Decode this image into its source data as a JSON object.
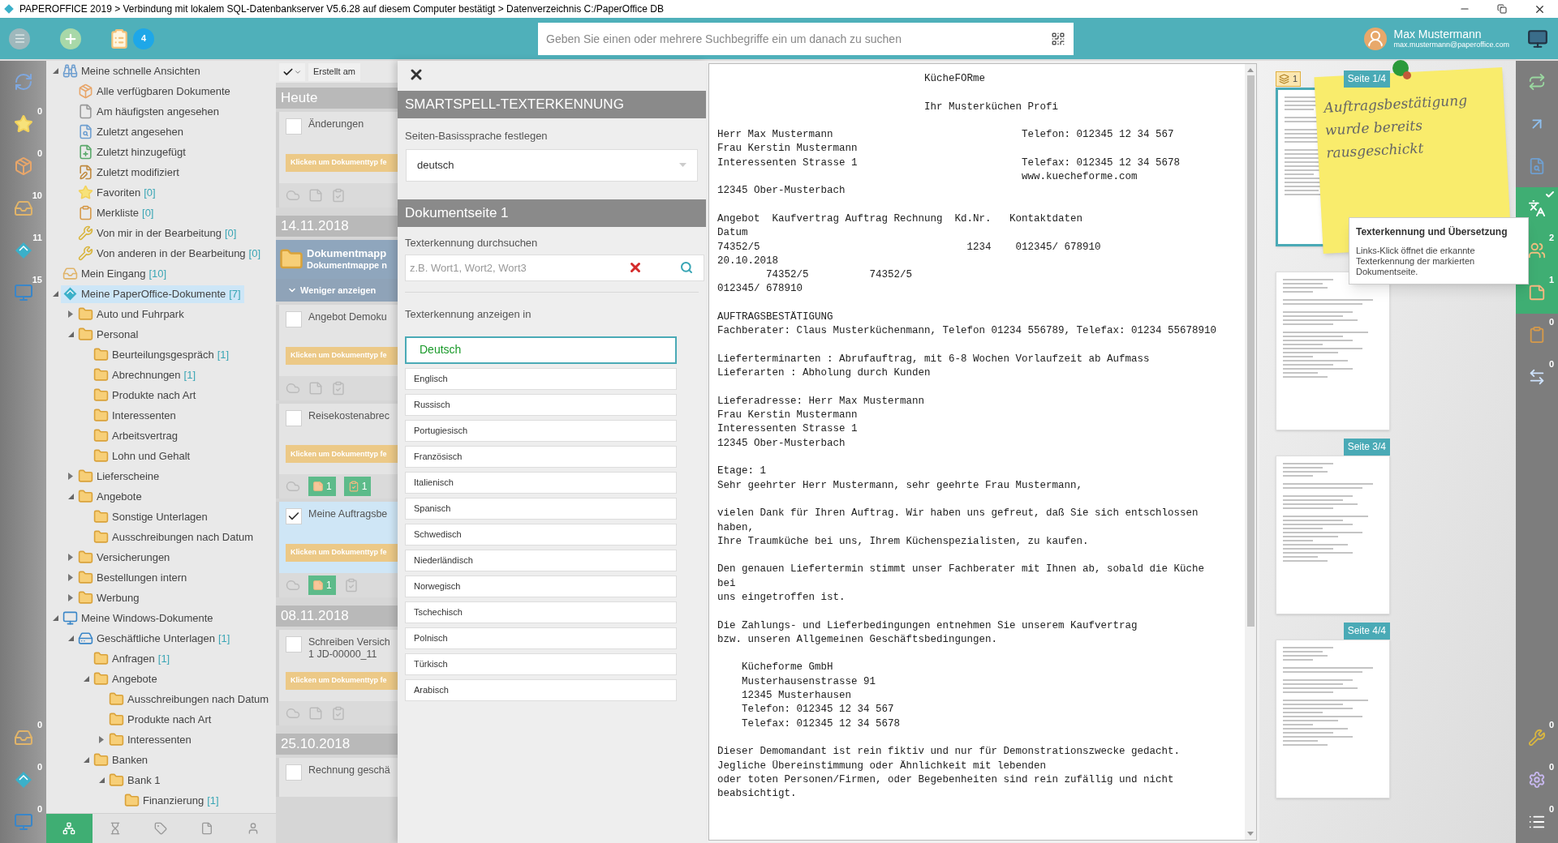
{
  "window": {
    "title": "PAPEROFFICE 2019 > Verbindung mit lokalem SQL-Datenbankserver V5.6.28 auf diesem Computer bestätigt > Datenverzeichnis C:/PaperOffice DB"
  },
  "toolbar": {
    "task_count": "4",
    "search": {
      "placeholder": "Geben Sie einen oder mehrere Suchbegriffe ein um danach zu suchen"
    },
    "user": {
      "name": "Max Mustermann",
      "email": "max.mustermann@paperoffice.com"
    }
  },
  "left_rail": {
    "top": [
      {
        "kind": "refresh"
      },
      {
        "kind": "star",
        "count": "0"
      },
      {
        "kind": "box",
        "count": "0"
      },
      {
        "kind": "inbox",
        "count": "10"
      },
      {
        "kind": "paperoffice",
        "count": "11"
      },
      {
        "kind": "windows",
        "count": "15"
      }
    ],
    "bottom": [
      {
        "kind": "inbox",
        "count": "0"
      },
      {
        "kind": "paperoffice",
        "count": "0"
      },
      {
        "kind": "windows",
        "count": "0"
      }
    ]
  },
  "tree": [
    {
      "label": "Meine schnelle Ansichten",
      "kind": "binoculars",
      "expanded": true,
      "selected": false,
      "children": [
        {
          "label": "Alle verfügbaren Dokumente",
          "kind": "box",
          "selected": false
        },
        {
          "label": "Am häufigsten angesehen",
          "kind": "file",
          "selected": false
        },
        {
          "label": "Zuletzt angesehen",
          "kind": "filesearch",
          "selected": false
        },
        {
          "label": "Zuletzt hinzugefügt",
          "kind": "fileplus",
          "selected": false
        },
        {
          "label": "Zuletzt modifiziert",
          "kind": "filepen",
          "selected": false
        },
        {
          "label": "Favoriten",
          "count": "[0]",
          "kind": "star",
          "selected": false
        },
        {
          "label": "Merkliste",
          "count": "[0]",
          "kind": "clipboard",
          "selected": false
        },
        {
          "label": "Von mir in der Bearbeitung",
          "count": "[0]",
          "kind": "wrench",
          "selected": false
        },
        {
          "label": "Von anderen in der Bearbeitung",
          "count": "[0]",
          "kind": "wrench",
          "selected": false
        }
      ]
    },
    {
      "label": "Mein Eingang",
      "count": "[10]",
      "kind": "inbox",
      "selected": false
    },
    {
      "label": "Meine PaperOffice-Dokumente",
      "count": "[7]",
      "kind": "paperoffice",
      "expanded": true,
      "selected": true,
      "children": [
        {
          "label": "Auto und Fuhrpark",
          "kind": "folder",
          "expanded": false,
          "selected": false
        },
        {
          "label": "Personal",
          "kind": "folder",
          "expanded": true,
          "selected": false,
          "children": [
            {
              "label": "Beurteilungsgespräch",
              "count": "[1]",
              "kind": "folder",
              "selected": false
            },
            {
              "label": "Abrechnungen",
              "count": "[1]",
              "kind": "folder",
              "selected": false
            },
            {
              "label": "Produkte nach Art",
              "kind": "folder",
              "selected": false
            },
            {
              "label": "Interessenten",
              "kind": "folder",
              "selected": false
            },
            {
              "label": "Arbeitsvertrag",
              "kind": "folder",
              "selected": false
            },
            {
              "label": "Lohn und Gehalt",
              "kind": "folder",
              "selected": false
            }
          ]
        },
        {
          "label": "Lieferscheine",
          "kind": "folder",
          "expanded": false,
          "selected": false
        },
        {
          "label": "Angebote",
          "kind": "folder",
          "expanded": true,
          "selected": false,
          "children": [
            {
              "label": "Sonstige Unterlagen",
              "kind": "folder",
              "selected": false
            },
            {
              "label": "Ausschreibungen nach Datum",
              "kind": "folder",
              "selected": false
            }
          ]
        },
        {
          "label": "Versicherungen",
          "kind": "folder",
          "expanded": false,
          "selected": false
        },
        {
          "label": "Bestellungen intern",
          "kind": "folder",
          "expanded": false,
          "selected": false
        },
        {
          "label": "Werbung",
          "kind": "folder",
          "expanded": false,
          "selected": false
        }
      ]
    },
    {
      "label": "Meine Windows-Dokumente",
      "kind": "windows",
      "expanded": true,
      "selected": false,
      "children": [
        {
          "label": "Geschäftliche Unterlagen",
          "count": "[1]",
          "kind": "drive",
          "expanded": true,
          "selected": false,
          "children": [
            {
              "label": "Anfragen",
              "count": "[1]",
              "kind": "folder",
              "selected": false
            },
            {
              "label": "Angebote",
              "kind": "folder",
              "expanded": true,
              "selected": false,
              "children": [
                {
                  "label": "Ausschreibungen nach Datum",
                  "kind": "folder",
                  "selected": false
                },
                {
                  "label": "Produkte nach Art",
                  "kind": "folder",
                  "selected": false
                },
                {
                  "label": "Interessenten",
                  "kind": "folder",
                  "expanded": false,
                  "selected": false
                }
              ]
            },
            {
              "label": "Banken",
              "kind": "folder",
              "expanded": true,
              "selected": false,
              "children": [
                {
                  "label": "Bank 1",
                  "kind": "folder",
                  "expanded": true,
                  "selected": false,
                  "children": [
                    {
                      "label": "Finanzierung",
                      "count": "[1]",
                      "kind": "folder",
                      "selected": false
                    }
                  ]
                }
              ]
            }
          ]
        }
      ]
    }
  ],
  "tree_tabs": [
    {
      "kind": "sitemap",
      "selected": true
    },
    {
      "kind": "hourglass",
      "selected": false
    },
    {
      "kind": "tag",
      "selected": false
    },
    {
      "kind": "file",
      "selected": false
    },
    {
      "kind": "user",
      "selected": false
    }
  ],
  "doc_list": {
    "sort": "Erstellt am",
    "groups": [
      {
        "date": "Heute",
        "items": [
          {
            "title": "Änderungen",
            "type": "Klicken um Dokumenttyp fe",
            "checked": false,
            "selected": false
          }
        ]
      },
      {
        "date": "14.11.2018",
        "folder": {
          "title": "Dokumentmapp",
          "subtitle": "Dokumentmappe n"
        },
        "toggle": "Weniger anzeigen",
        "items": [
          {
            "title": "Angebot Demoku",
            "type": "Klicken um Dokumenttyp fe",
            "checked": false,
            "selected": false
          },
          {
            "title": "Reisekostenabrec",
            "type": "Klicken um Dokumenttyp fe",
            "checked": false,
            "selected": false,
            "notes": "1",
            "tasks": "1"
          },
          {
            "title": "Meine Auftragsbe",
            "type": "Klicken um Dokumenttyp fe",
            "checked": true,
            "selected": true,
            "notes": "1"
          }
        ]
      },
      {
        "date": "08.11.2018",
        "items": [
          {
            "title": "Schreiben Versich",
            "subtitle": "1 JD-00000_11",
            "type": "Klicken um Dokumenttyp fe",
            "checked": false,
            "selected": false
          }
        ]
      },
      {
        "date": "25.10.2018",
        "items": [
          {
            "title": "Rechnung geschä",
            "checked": false,
            "selected": false
          }
        ]
      }
    ]
  },
  "smartspell": {
    "title": "SMARTSPELL-TEXTERKENNUNG",
    "base_language_label": "Seiten-Basissprache festlegen",
    "base_language": "deutsch",
    "page_title": "Dokumentseite 1",
    "search_label": "Texterkennung durchsuchen",
    "search": {
      "placeholder": "z.B. Wort1, Wort2, Wort3"
    },
    "languages_label": "Texterkennung anzeigen in",
    "languages": [
      {
        "label": "Deutsch",
        "selected": true
      },
      {
        "label": "Englisch",
        "selected": false
      },
      {
        "label": "Russisch",
        "selected": false
      },
      {
        "label": "Portugiesisch",
        "selected": false
      },
      {
        "label": "Französisch",
        "selected": false
      },
      {
        "label": "Italienisch",
        "selected": false
      },
      {
        "label": "Spanisch",
        "selected": false
      },
      {
        "label": "Schwedisch",
        "selected": false
      },
      {
        "label": "Niederländisch",
        "selected": false
      },
      {
        "label": "Norwegisch",
        "selected": false
      },
      {
        "label": "Tschechisch",
        "selected": false
      },
      {
        "label": "Polnisch",
        "selected": false
      },
      {
        "label": "Türkisch",
        "selected": false
      },
      {
        "label": "Arabisch",
        "selected": false
      }
    ]
  },
  "document": {
    "blocks": [
      [
        "                                  KücheFORme"
      ],
      [
        "                                  Ihr Musterküchen Profi"
      ],
      [
        "Herr Max Mustermann                               Telefon: 012345 12 34 567",
        "Frau Kerstin Mustermann",
        "Interessenten Strasse 1                           Telefax: 012345 12 34 5678",
        "                                                  www.kuecheforme.com",
        "12345 Ober-Musterbach"
      ],
      [
        "Angebot  Kaufvertrag Auftrag Rechnung  Kd.Nr.   Kontaktdaten",
        "Datum",
        "74352/5                                  1234    012345/ 678910",
        "20.10.2018",
        "        74352/5          74352/5",
        "012345/ 678910"
      ],
      [
        "AUFTRAGSBESTÄTIGUNG",
        "Fachberater: Claus Musterküchenmann, Telefon 01234 556789, Telefax: 01234 55678910"
      ],
      [
        "Lieferterminarten : Abrufauftrag, mit 6-8 Wochen Vorlaufzeit ab Aufmass",
        "Lieferarten : Abholung durch Kunden"
      ],
      [
        "Lieferadresse: Herr Max Mustermann",
        "Frau Kerstin Mustermann",
        "Interessenten Strasse 1",
        "12345 Ober-Musterbach"
      ],
      [
        "Etage: 1",
        "Sehr geehrter Herr Mustermann, sehr geehrte Frau Mustermann,"
      ],
      [
        "vielen Dank für Ihren Auftrag. Wir haben uns gefreut, daß Sie sich entschlossen",
        "haben,",
        "Ihre Traumküche bei uns, Ihrem Küchenspezialisten, zu kaufen."
      ],
      [
        "Den genauen Liefertermin stimmt unser Fachberater mit Ihnen ab, sobald die Küche",
        "bei",
        "uns eingetroffen ist."
      ],
      [
        "Die Zahlungs- und Lieferbedingungen entnehmen Sie unserem Kaufvertrag",
        "bzw. unseren Allgemeinen Geschäftsbedingungen."
      ],
      [
        "    Kücheforme GmbH",
        "    Musterhausenstrasse 91",
        "    12345 Musterhausen",
        "    Telefon: 012345 12 34 567",
        "    Telefax: 012345 12 34 5678"
      ],
      [
        "Dieser Demomandant ist rein fiktiv und nur für Demonstrationszwecke gedacht.",
        "Jegliche Übereinstimmung oder Ähnlichkeit mit lebenden",
        "oder toten Personen/Firmen, oder Begebenheiten sind rein zufällig und nicht",
        "beabsichtigt."
      ]
    ]
  },
  "thumbnails": {
    "pages": [
      {
        "label": "Seite 1/4",
        "badge": "1",
        "selected": true
      },
      {
        "selected": false
      },
      {
        "label": "Seite 3/4",
        "selected": false
      },
      {
        "label": "Seite 4/4",
        "selected": false
      }
    ],
    "note": "Auftragsbestätigung wurde bereits rausgeschickt",
    "tooltip": {
      "title": "Texterkennung und Übersetzung",
      "text": "Links-Klick öffnet die erkannte Texterkennung der markierten Dokumentseite."
    }
  },
  "right_rail": {
    "top": [
      {
        "kind": "sync",
        "active": false,
        "checked": false
      },
      {
        "kind": "arrow",
        "active": false,
        "checked": false
      },
      {
        "kind": "filesearch",
        "active": false,
        "checked": false
      },
      {
        "kind": "translate",
        "active": true,
        "checked": true
      },
      {
        "kind": "users",
        "count": "2",
        "active": true,
        "checked": false
      },
      {
        "kind": "note",
        "count": "1",
        "active": true,
        "checked": false
      },
      {
        "kind": "clipboard",
        "count": "0",
        "active": false,
        "checked": false
      },
      {
        "kind": "compare",
        "count": "0",
        "active": false,
        "checked": false
      }
    ],
    "bottom": [
      {
        "kind": "wrench",
        "count": "0",
        "active": false,
        "checked": false
      },
      {
        "kind": "gear",
        "count": "0",
        "active": false,
        "checked": false
      },
      {
        "kind": "list",
        "count": "0",
        "active": false,
        "checked": false
      }
    ]
  }
}
